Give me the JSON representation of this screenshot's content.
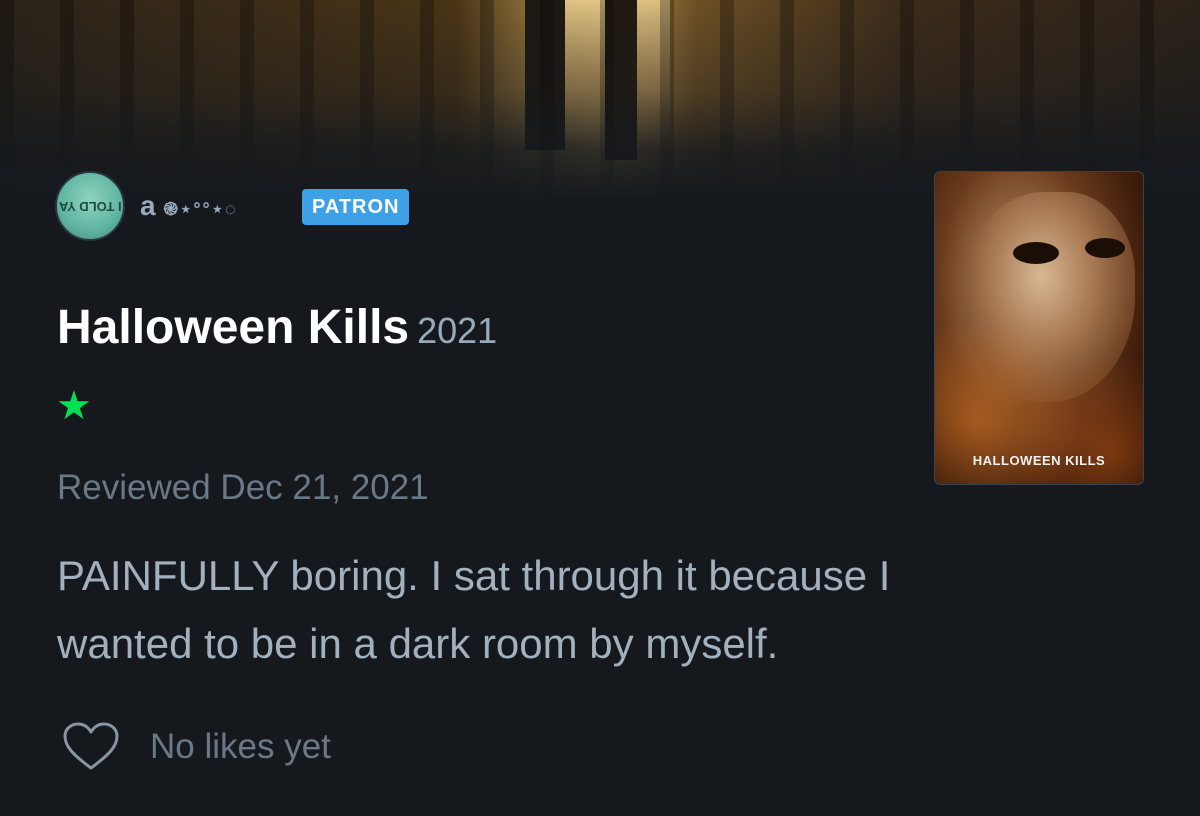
{
  "user": {
    "name": "a",
    "name_decoration": "֎⋆°°⋆◌",
    "avatar_text": "I TOLD YA",
    "badge": "PATRON"
  },
  "film": {
    "title": "Halloween Kills",
    "year": "2021",
    "poster_title": "HALLOWEEN KILLS"
  },
  "review": {
    "rating_stars": "★",
    "rating_value": 1,
    "rating_color": "#00e054",
    "reviewed_date": "Reviewed Dec 21, 2021",
    "body": "PAINFULLY boring. I sat through it because I wanted to be in a dark room by myself."
  },
  "likes": {
    "icon": "heart-icon",
    "text": "No likes yet"
  },
  "colors": {
    "background": "#15191e",
    "patron_badge": "#3ea1e6",
    "muted_text": "#6b7886",
    "body_text": "#a3b1bf"
  }
}
